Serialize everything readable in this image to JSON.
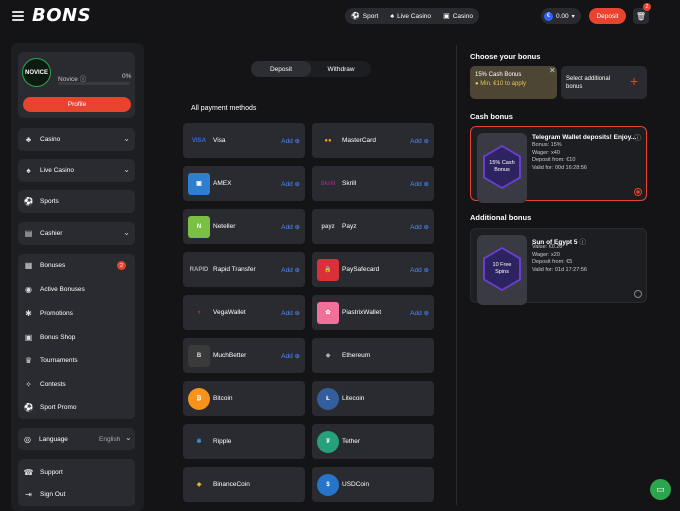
{
  "header": {
    "logo": "BONS",
    "nav": [
      {
        "icon": "sport-icon",
        "label": "Sport"
      },
      {
        "icon": "live-casino-icon",
        "label": "Live Casino"
      },
      {
        "icon": "casino-icon",
        "label": "Casino"
      }
    ],
    "currency_symbol": "€",
    "balance": "0.00",
    "deposit_label": "Deposit",
    "cart_badge": "2"
  },
  "sidebar": {
    "avatar_text": "NOVICE",
    "level_label": "Novice",
    "level_percent": "0%",
    "profile_label": "Profile",
    "sections": [
      {
        "label": "Casino",
        "icon": "casino-icon"
      },
      {
        "label": "Live Casino",
        "icon": "live-casino-icon"
      },
      {
        "label": "Sports",
        "icon": "sports-icon"
      },
      {
        "label": "Cashier",
        "icon": "cashier-icon"
      }
    ],
    "group": [
      {
        "label": "Bonuses",
        "icon": "bonuses-icon"
      },
      {
        "label": "Active Bonuses",
        "icon": "active-bonuses-icon"
      },
      {
        "label": "Promotions",
        "icon": "promotions-icon"
      },
      {
        "label": "Bonus Shop",
        "icon": "bonus-shop-icon"
      },
      {
        "label": "Tournaments",
        "icon": "tournaments-icon"
      },
      {
        "label": "Contests",
        "icon": "contests-icon"
      },
      {
        "label": "Sport Promo",
        "icon": "sport-promo-icon"
      }
    ],
    "bonuses_badge": "2",
    "language_label": "Language",
    "language_value": "English",
    "support_label": "Support",
    "signout_label": "Sign Out"
  },
  "cashier": {
    "tabs": [
      "Deposit",
      "Withdraw"
    ],
    "active_tab": "Deposit",
    "methods_title": "All payment methods",
    "add_label": "Add",
    "methods": [
      {
        "name": "Visa",
        "logo": "VISA",
        "addable": true
      },
      {
        "name": "MasterCard",
        "logo": "",
        "addable": true
      },
      {
        "name": "AMEX",
        "logo": "",
        "addable": true
      },
      {
        "name": "Skrill",
        "logo": "Skrill",
        "addable": true
      },
      {
        "name": "Neteller",
        "logo": "N",
        "addable": true
      },
      {
        "name": "Payz",
        "logo": "payz",
        "addable": true
      },
      {
        "name": "Rapid Transfer",
        "logo": "RAPID",
        "addable": true
      },
      {
        "name": "PaySafecard",
        "logo": "",
        "addable": true
      },
      {
        "name": "VegaWallet",
        "logo": "",
        "addable": true
      },
      {
        "name": "PiastrixWallet",
        "logo": "",
        "addable": true
      },
      {
        "name": "MuchBetter",
        "logo": "",
        "addable": true
      },
      {
        "name": "Ethereum",
        "logo": "",
        "addable": false
      },
      {
        "name": "Bitcoin",
        "logo": "₿",
        "addable": false
      },
      {
        "name": "Litecoin",
        "logo": "Ł",
        "addable": false
      },
      {
        "name": "Ripple",
        "logo": "",
        "addable": false
      },
      {
        "name": "Tether",
        "logo": "₮",
        "addable": false
      },
      {
        "name": "BinanceCoin",
        "logo": "",
        "addable": false
      },
      {
        "name": "USDCoin",
        "logo": "$",
        "addable": false
      }
    ]
  },
  "bonus_panel": {
    "choose_title": "Choose your bonus",
    "selected_bonus": "15% Cash Bonus",
    "selected_min": "Min. €10 to apply",
    "select_additional": "Select additional bonus",
    "cash_bonus_title": "Cash bonus",
    "cash_bonus": {
      "badge": "15% Cash Bonus",
      "title": "Telegram Wallet deposits! Enjoy...",
      "lines": [
        "Bonus: 15%",
        "Wager: x40",
        "Deposit from: €10",
        "Valid for: 00d  16:28:56"
      ]
    },
    "additional_title": "Additional bonus",
    "additional_bonus": {
      "badge": "10 Free Spins",
      "title": "Sun of Egypt 5",
      "lines": [
        "Value: €0.20",
        "Wager: x20",
        "Deposit from: €5",
        "Valid for: 01d  17:27:56"
      ]
    },
    "accent_color": "#e8432f"
  }
}
